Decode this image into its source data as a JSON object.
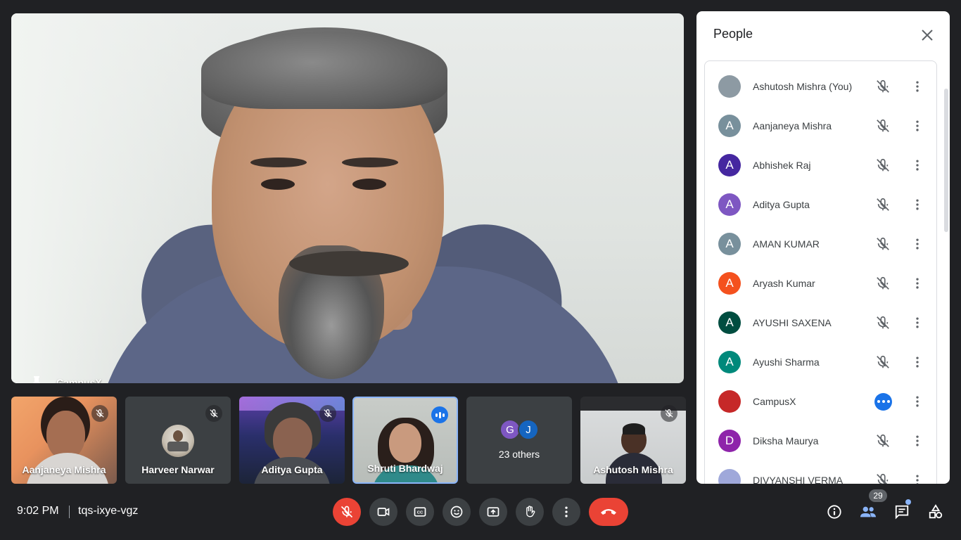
{
  "main": {
    "speaker_name": "CampusX"
  },
  "tiles": [
    {
      "name": "Aanjaneya Mishra"
    },
    {
      "name": "Harveer Narwar"
    },
    {
      "name": "Aditya Gupta"
    },
    {
      "name": "Shruti Bhardwaj"
    },
    {
      "others_label": "23 others",
      "avatars": [
        "G",
        "J"
      ]
    },
    {
      "name": "Ashutosh Mishra"
    }
  ],
  "panel": {
    "title": "People",
    "participants": [
      {
        "name": "Ashutosh Mishra (You)",
        "initial": "",
        "color": "#8d9aa3"
      },
      {
        "name": "Aanjaneya Mishra",
        "initial": "A",
        "color": "#78909c"
      },
      {
        "name": "Abhishek Raj",
        "initial": "A",
        "color": "#4527a0"
      },
      {
        "name": "Aditya Gupta",
        "initial": "A",
        "color": "#7e57c2"
      },
      {
        "name": "AMAN KUMAR",
        "initial": "A",
        "color": "#78909c"
      },
      {
        "name": "Aryash Kumar",
        "initial": "A",
        "color": "#f4511e"
      },
      {
        "name": "AYUSHI SAXENA",
        "initial": "A",
        "color": "#004d40"
      },
      {
        "name": "Ayushi Sharma",
        "initial": "A",
        "color": "#00897b"
      },
      {
        "name": "CampusX",
        "initial": "",
        "color": "#c62828"
      },
      {
        "name": "Diksha Maurya",
        "initial": "D",
        "color": "#8e24aa"
      },
      {
        "name": "DIVYANSHI VERMA",
        "initial": "",
        "color": "#9fa8da"
      }
    ]
  },
  "bottom": {
    "time": "9:02 PM",
    "meeting_code": "tqs-ixye-vgz",
    "people_count": "29"
  },
  "colors": {
    "accent": "#1a73e8",
    "danger": "#ea4335",
    "bar_bg": "#202124"
  }
}
